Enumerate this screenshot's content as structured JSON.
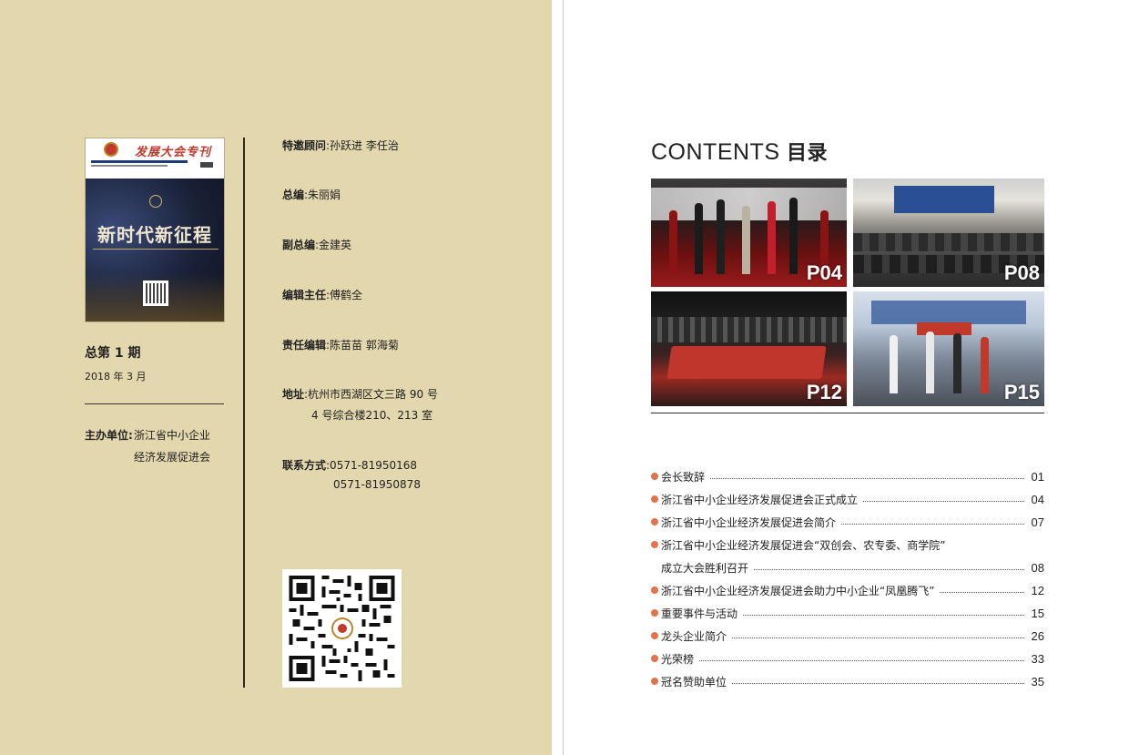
{
  "cover": {
    "masthead": "发展大会专刊",
    "headline": "新时代新征程"
  },
  "issue": {
    "number": "总第 1 期",
    "date": "2018 年 3 月"
  },
  "host": {
    "label": "主办单位:",
    "line1": "浙江省中小企业",
    "line2": "经济发展促进会"
  },
  "staff": {
    "advisors_label": "特邀顾问",
    "advisors": ":孙跃进  李任治",
    "chief_label": "总编",
    "chief": ":朱丽娟",
    "deputy_label": "副总编",
    "deputy": ":金建英",
    "director_label": "编辑主任",
    "director": ":傅鹤全",
    "editors_label": "责任编辑",
    "editors": ":陈苗苗  郭海菊",
    "address_label": "地址",
    "address1": ":杭州市西湖区文三路 90 号",
    "address2": "4 号综合楼210、213 室",
    "contact_label": "联系方式",
    "phone1": ":0571-81950168",
    "phone2": "0571-81950878"
  },
  "contents": {
    "title_en": "CONTENTS",
    "title_cn": "目录",
    "photos": [
      {
        "label": "P04"
      },
      {
        "label": "P08"
      },
      {
        "label": "P12"
      },
      {
        "label": "P15"
      }
    ],
    "items": [
      {
        "text": "会长致辞",
        "page": "01",
        "bullet": true
      },
      {
        "text": "浙江省中小企业经济发展促进会正式成立",
        "page": "04",
        "bullet": true
      },
      {
        "text": "浙江省中小企业经济发展促进会简介",
        "page": "07",
        "bullet": true
      },
      {
        "text": "浙江省中小企业经济发展促进会“双创会、农专委、商学院”",
        "page": "",
        "bullet": true
      },
      {
        "text": "成立大会胜利召开",
        "page": "08",
        "bullet": false
      },
      {
        "text": "浙江省中小企业经济发展促进会助力中小企业“凤凰腾飞”",
        "page": "12",
        "bullet": true
      },
      {
        "text": "重要事件与活动",
        "page": "15",
        "bullet": true
      },
      {
        "text": "龙头企业简介",
        "page": "26",
        "bullet": true
      },
      {
        "text": "光荣榜",
        "page": "33",
        "bullet": true
      },
      {
        "text": "冠名赞助单位",
        "page": "35",
        "bullet": true
      }
    ],
    "bullet_color": "#e2734a"
  },
  "colors": {
    "left_page_bg": "#e3d7ae",
    "accent_red": "#c0392b"
  }
}
